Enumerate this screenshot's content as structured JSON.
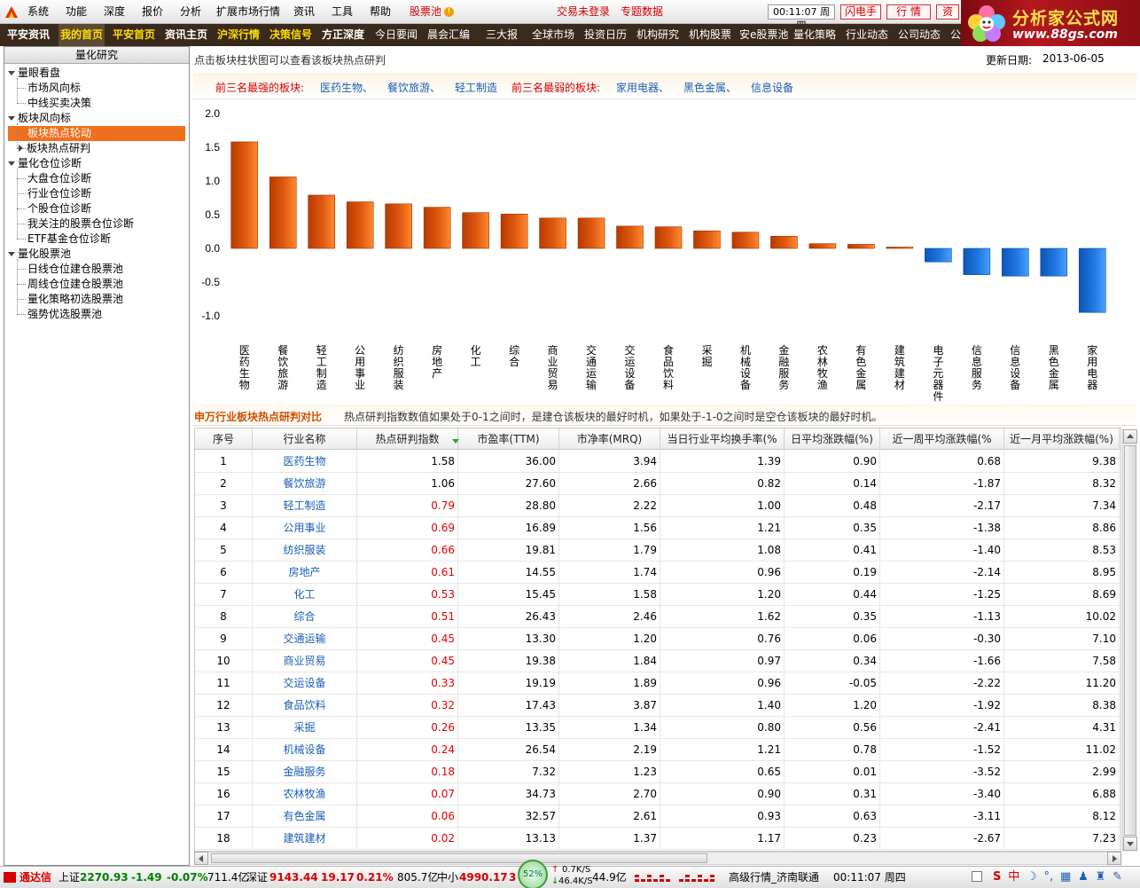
{
  "menubar": {
    "items": [
      "系统",
      "功能",
      "深度",
      "报价",
      "分析",
      "扩展市场行情",
      "资讯",
      "工具",
      "帮助"
    ],
    "stock_pool": "股票池",
    "status_text": "交易未登录",
    "special_data": "专题数据",
    "clock": "00:11:07 周四",
    "flash": "闪电手",
    "market": "行  情",
    "info": "资"
  },
  "navbar": {
    "items": [
      "平安资讯",
      "我的首页",
      "平安首页",
      "资讯主页",
      "沪深行情",
      "决策信号",
      "方正深度",
      "今日要闻",
      "晨会汇编",
      "三大报",
      "全球市场",
      "投资日历",
      "机构研究",
      "机构股票",
      "安e股票池",
      "量化策略",
      "行业动态",
      "公司动态",
      "公"
    ]
  },
  "brand": {
    "title": "分析家公式网",
    "url": "www.88gs.com"
  },
  "left_panel": {
    "title": "量化研究",
    "tree": [
      {
        "label": "量眼看盘",
        "level": 0,
        "expanded": true
      },
      {
        "label": "市场风向标",
        "level": 1
      },
      {
        "label": "中线买卖决策",
        "level": 1
      },
      {
        "label": "板块风向标",
        "level": 0,
        "expanded": true
      },
      {
        "label": "板块热点轮动",
        "level": 1,
        "selected": true
      },
      {
        "label": "板块热点研判",
        "level": 1,
        "collapsed": true
      },
      {
        "label": "量化仓位诊断",
        "level": 0,
        "expanded": true
      },
      {
        "label": "大盘仓位诊断",
        "level": 1
      },
      {
        "label": "行业仓位诊断",
        "level": 1
      },
      {
        "label": "个股仓位诊断",
        "level": 1
      },
      {
        "label": "我关注的股票仓位诊断",
        "level": 1
      },
      {
        "label": "ETF基金仓位诊断",
        "level": 1
      },
      {
        "label": "量化股票池",
        "level": 0,
        "expanded": true
      },
      {
        "label": "日线仓位建仓股票池",
        "level": 1
      },
      {
        "label": "周线仓位建仓股票池",
        "level": 1
      },
      {
        "label": "量化策略初选股票池",
        "level": 1
      },
      {
        "label": "强势优选股票池",
        "level": 1
      }
    ]
  },
  "main": {
    "hint": "点击板块柱状图可以查看该板块热点研判",
    "update_label": "更新日期:",
    "update_date": "2013-06-05",
    "strongest_label": "前三名最强的板块:",
    "strongest": [
      "医药生物、",
      "餐饮旅游、",
      "轻工制造"
    ],
    "weakest_label": "前三名最弱的板块:",
    "weakest": [
      "家用电器、",
      "黑色金属、",
      "信息设备"
    ],
    "section_title": "申万行业板块热点研判对比",
    "section_desc": "热点研判指数数值如果处于0-1之间时，是建仓该板块的最好时机，如果处于-1-0之间时是空仓该板块的最好时机。"
  },
  "chart_data": {
    "type": "bar",
    "categories": [
      "医药生物",
      "餐饮旅游",
      "轻工制造",
      "公用事业",
      "纺织服装",
      "房地产",
      "化工",
      "综合",
      "商业贸易",
      "交通运输",
      "交运设备",
      "食品饮料",
      "采掘",
      "机械设备",
      "金融服务",
      "农林牧渔",
      "有色金属",
      "建筑建材",
      "电子元器件",
      "信息服务",
      "信息设备",
      "黑色金属",
      "家用电器"
    ],
    "values": [
      1.58,
      1.06,
      0.79,
      0.69,
      0.66,
      0.61,
      0.53,
      0.51,
      0.45,
      0.45,
      0.33,
      0.32,
      0.26,
      0.24,
      0.18,
      0.07,
      0.06,
      0.02,
      -0.2,
      -0.39,
      -0.41,
      -0.41,
      -0.95
    ],
    "yticks": [
      "2.0",
      "1.5",
      "1.0",
      "0.5",
      "0.0",
      "-0.5",
      "-1.0"
    ],
    "ylim": [
      -1.0,
      2.0
    ],
    "positive_color": "#e05a10",
    "negative_color": "#1e78e0"
  },
  "table": {
    "columns": [
      "序号",
      "行业名称",
      "热点研判指数",
      "市盈率(TTM)",
      "市净率(MRQ)",
      "当日行业平均换手率(%",
      "日平均涨跌幅(%)",
      "近一周平均涨跌幅(%",
      "近一月平均涨跌幅(%)"
    ],
    "rows": [
      [
        "1",
        "医药生物",
        "1.58",
        "36.00",
        "3.94",
        "1.39",
        "0.90",
        "0.68",
        "9.38"
      ],
      [
        "2",
        "餐饮旅游",
        "1.06",
        "27.60",
        "2.66",
        "0.82",
        "0.14",
        "-1.87",
        "8.32"
      ],
      [
        "3",
        "轻工制造",
        "0.79",
        "28.80",
        "2.22",
        "1.00",
        "0.48",
        "-2.17",
        "7.34"
      ],
      [
        "4",
        "公用事业",
        "0.69",
        "16.89",
        "1.56",
        "1.21",
        "0.35",
        "-1.38",
        "8.86"
      ],
      [
        "5",
        "纺织服装",
        "0.66",
        "19.81",
        "1.79",
        "1.08",
        "0.41",
        "-1.40",
        "8.53"
      ],
      [
        "6",
        "房地产",
        "0.61",
        "14.55",
        "1.74",
        "0.96",
        "0.19",
        "-2.14",
        "8.95"
      ],
      [
        "7",
        "化工",
        "0.53",
        "15.45",
        "1.58",
        "1.20",
        "0.44",
        "-1.25",
        "8.69"
      ],
      [
        "8",
        "综合",
        "0.51",
        "26.43",
        "2.46",
        "1.62",
        "0.35",
        "-1.13",
        "10.02"
      ],
      [
        "9",
        "交通运输",
        "0.45",
        "13.30",
        "1.20",
        "0.76",
        "0.06",
        "-0.30",
        "7.10"
      ],
      [
        "10",
        "商业贸易",
        "0.45",
        "19.38",
        "1.84",
        "0.97",
        "0.34",
        "-1.66",
        "7.58"
      ],
      [
        "11",
        "交运设备",
        "0.33",
        "19.19",
        "1.89",
        "0.96",
        "-0.05",
        "-2.22",
        "11.20"
      ],
      [
        "12",
        "食品饮料",
        "0.32",
        "17.43",
        "3.87",
        "1.40",
        "1.20",
        "-1.92",
        "8.38"
      ],
      [
        "13",
        "采掘",
        "0.26",
        "13.35",
        "1.34",
        "0.80",
        "0.56",
        "-2.41",
        "4.31"
      ],
      [
        "14",
        "机械设备",
        "0.24",
        "26.54",
        "2.19",
        "1.21",
        "0.78",
        "-1.52",
        "11.02"
      ],
      [
        "15",
        "金融服务",
        "0.18",
        "7.32",
        "1.23",
        "0.65",
        "0.01",
        "-3.52",
        "2.99"
      ],
      [
        "16",
        "农林牧渔",
        "0.07",
        "34.73",
        "2.70",
        "0.90",
        "0.31",
        "-3.40",
        "6.88"
      ],
      [
        "17",
        "有色金属",
        "0.06",
        "32.57",
        "2.61",
        "0.93",
        "0.63",
        "-3.11",
        "8.12"
      ],
      [
        "18",
        "建筑建材",
        "0.02",
        "13.13",
        "1.37",
        "1.17",
        "0.23",
        "-2.67",
        "7.23"
      ]
    ]
  },
  "statusbar": {
    "brand": "通达信",
    "sh_label": "上证",
    "sh_index": "2270.93",
    "sh_change": "-1.49",
    "sh_pct": "-0.07%",
    "sh_amount": "711.4亿",
    "sz_label": "深证",
    "sz_index": "9143.44",
    "sz_change": "19.17",
    "sz_pct": "0.21%",
    "sz_amount": "805.7亿",
    "zx_label": "中小",
    "zx_index": "4990.17",
    "zx_change": "3",
    "gauge": "52%",
    "up_speed": "0.7K/S",
    "down_speed": "46.4K/S",
    "amount2": "44.9亿",
    "server": "高级行情_济南联通",
    "time": "00:11:07 周四"
  }
}
